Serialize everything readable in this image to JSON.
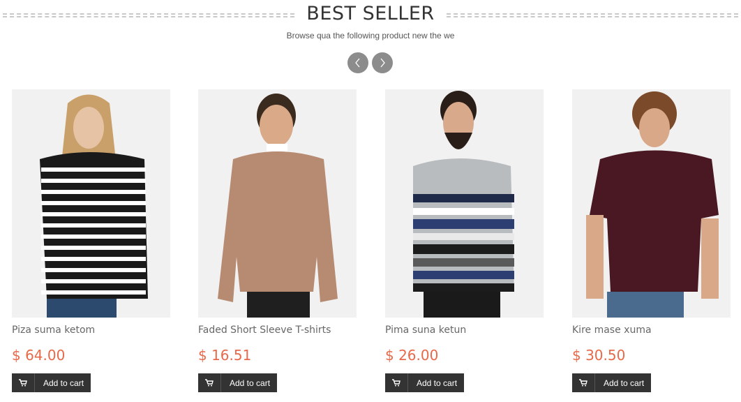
{
  "section": {
    "title": "BEST SELLER",
    "subtitle": "Browse qua the following product new the we"
  },
  "carousel": {
    "prev_icon": "chevron-left-icon",
    "next_icon": "chevron-right-icon"
  },
  "colors": {
    "price": "#e8694a",
    "button_bg": "#333333",
    "nav_bg": "#8c8c8c"
  },
  "products": [
    {
      "name": "Piza suma ketom",
      "price": "$ 64.00",
      "cart_label": "Add to cart",
      "image": "man-striped-longsleeve"
    },
    {
      "name": "Faded Short Sleeve T-shirts",
      "price": "$ 16.51",
      "cart_label": "Add to cart",
      "image": "man-tan-sweater"
    },
    {
      "name": "Pima suna ketun",
      "price": "$ 26.00",
      "cart_label": "Add to cart",
      "image": "man-striped-sweater"
    },
    {
      "name": "Kire mase xuma",
      "price": "$ 30.50",
      "cart_label": "Add to cart",
      "image": "man-burgundy-polo"
    }
  ]
}
